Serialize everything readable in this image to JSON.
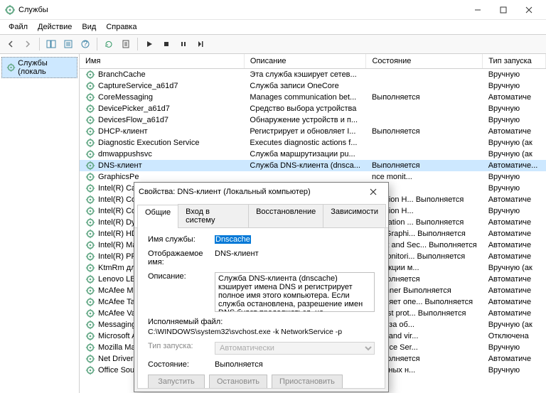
{
  "window": {
    "title": "Службы"
  },
  "menu": {
    "file": "Файл",
    "action": "Действие",
    "view": "Вид",
    "help": "Справка"
  },
  "tree": {
    "root": "Службы (локаль"
  },
  "columns": {
    "name": "Имя",
    "desc": "Описание",
    "state": "Состояние",
    "startup": "Тип запуска"
  },
  "rows": [
    {
      "name": "BranchCache",
      "desc": "Эта служба кэширует сетев...",
      "state": "",
      "startup": "Вручную"
    },
    {
      "name": "CaptureService_a61d7",
      "desc": "Служба записи OneCore",
      "state": "",
      "startup": "Вручную"
    },
    {
      "name": "CoreMessaging",
      "desc": "Manages communication bet...",
      "state": "Выполняется",
      "startup": "Автоматиче"
    },
    {
      "name": "DevicePicker_a61d7",
      "desc": "Средство выбора устройства",
      "state": "",
      "startup": "Вручную"
    },
    {
      "name": "DevicesFlow_a61d7",
      "desc": "Обнаружение устройств и п...",
      "state": "",
      "startup": "Вручную"
    },
    {
      "name": "DHCP-клиент",
      "desc": "Регистрирует и обновляет I...",
      "state": "Выполняется",
      "startup": "Автоматиче"
    },
    {
      "name": "Diagnostic Execution Service",
      "desc": "Executes diagnostic actions f...",
      "state": "",
      "startup": "Вручную (ак"
    },
    {
      "name": "dmwappushsvc",
      "desc": "Служба маршрутизации pu...",
      "state": "",
      "startup": "Вручную (ак"
    },
    {
      "name": "DNS-клиент",
      "desc": "Служба DNS-клиента (dnsca...",
      "state": "Выполняется",
      "startup": "Автоматиче..."
    },
    {
      "name": "GraphicsPe",
      "desc": "",
      "state": "nce monit...",
      "startup": "Вручную"
    },
    {
      "name": "Intel(R) Cap",
      "desc": "",
      "state": "",
      "startup": "Вручную"
    },
    {
      "name": "Intel(R) Co",
      "desc": "",
      "state": "otection H...   Выполняется",
      "startup": "Автоматиче"
    },
    {
      "name": "Intel(R) Co",
      "desc": "",
      "state": "otection H...",
      "startup": "Вручную"
    },
    {
      "name": "Intel(R) Dyn",
      "desc": "",
      "state": "pplication ...   Выполняется",
      "startup": "Автоматиче"
    },
    {
      "name": "Intel(R) HD",
      "desc": "",
      "state": "HD Graphi...    Выполняется",
      "startup": "Автоматиче"
    },
    {
      "name": "Intel(R) Ma",
      "desc": "",
      "state": "ment and Sec...   Выполняется",
      "startup": "Автоматиче"
    },
    {
      "name": "Intel(R) PR",
      "desc": "",
      "state": "et Monitori...   Выполняется",
      "startup": "Автоматиче"
    },
    {
      "name": "KtmRm для",
      "desc": "",
      "state": "анзакции м...",
      "startup": "Вручную (ак"
    },
    {
      "name": "Lenovo LBA",
      "desc": "",
      "state": "Выполняется",
      "startup": "Автоматиче"
    },
    {
      "name": "McAfee Mc",
      "desc": "",
      "state": "Scanner       Выполняется",
      "startup": "Автоматиче"
    },
    {
      "name": "McAfee Tas",
      "desc": "",
      "state": "равляет опе...   Выполняется",
      "startup": "Автоматиче"
    },
    {
      "name": "McAfee Vali",
      "desc": "",
      "state": "n trust prot...   Выполняется",
      "startup": "Автоматиче"
    },
    {
      "name": "MessagingS",
      "desc": "",
      "state": "щая за об...",
      "startup": "Вручную (ак"
    },
    {
      "name": "Microsoft A",
      "desc": "",
      "state": "sers and vir...",
      "startup": "Отключена"
    },
    {
      "name": "Mozilla Mai",
      "desc": "",
      "state": "enance Ser...",
      "startup": "Вручную"
    },
    {
      "name": "Net Driver H",
      "desc": "",
      "state": "Выполняется",
      "startup": "Автоматиче"
    },
    {
      "name": "Office  Sou",
      "desc": "",
      "state": "овочных н...",
      "startup": "Вручную"
    }
  ],
  "dialog": {
    "title": "Свойства: DNS-клиент (Локальный компьютер)",
    "tabs": {
      "general": "Общие",
      "logon": "Вход в систему",
      "recovery": "Восстановление",
      "deps": "Зависимости"
    },
    "labels": {
      "svc_name": "Имя службы:",
      "display_name": "Отображаемое имя:",
      "desc": "Описание:",
      "exe": "Исполняемый файл:",
      "startup": "Тип запуска:",
      "state": "Состояние:"
    },
    "values": {
      "svc_name": "Dnscache",
      "display_name": "DNS-клиент",
      "desc": "Служба DNS-клиента (dnscache) кэширует имена DNS и регистрирует полное имя этого компьютера. Если служба остановлена, разрешение имен DNS будет продолжаться, но",
      "exe": "C:\\WINDOWS\\system32\\svchost.exe -k NetworkService -p",
      "startup": "Автоматически",
      "state": "Выполняется"
    },
    "buttons": {
      "start": "Запустить",
      "stop": "Остановить",
      "pause": "Приостановить"
    }
  }
}
